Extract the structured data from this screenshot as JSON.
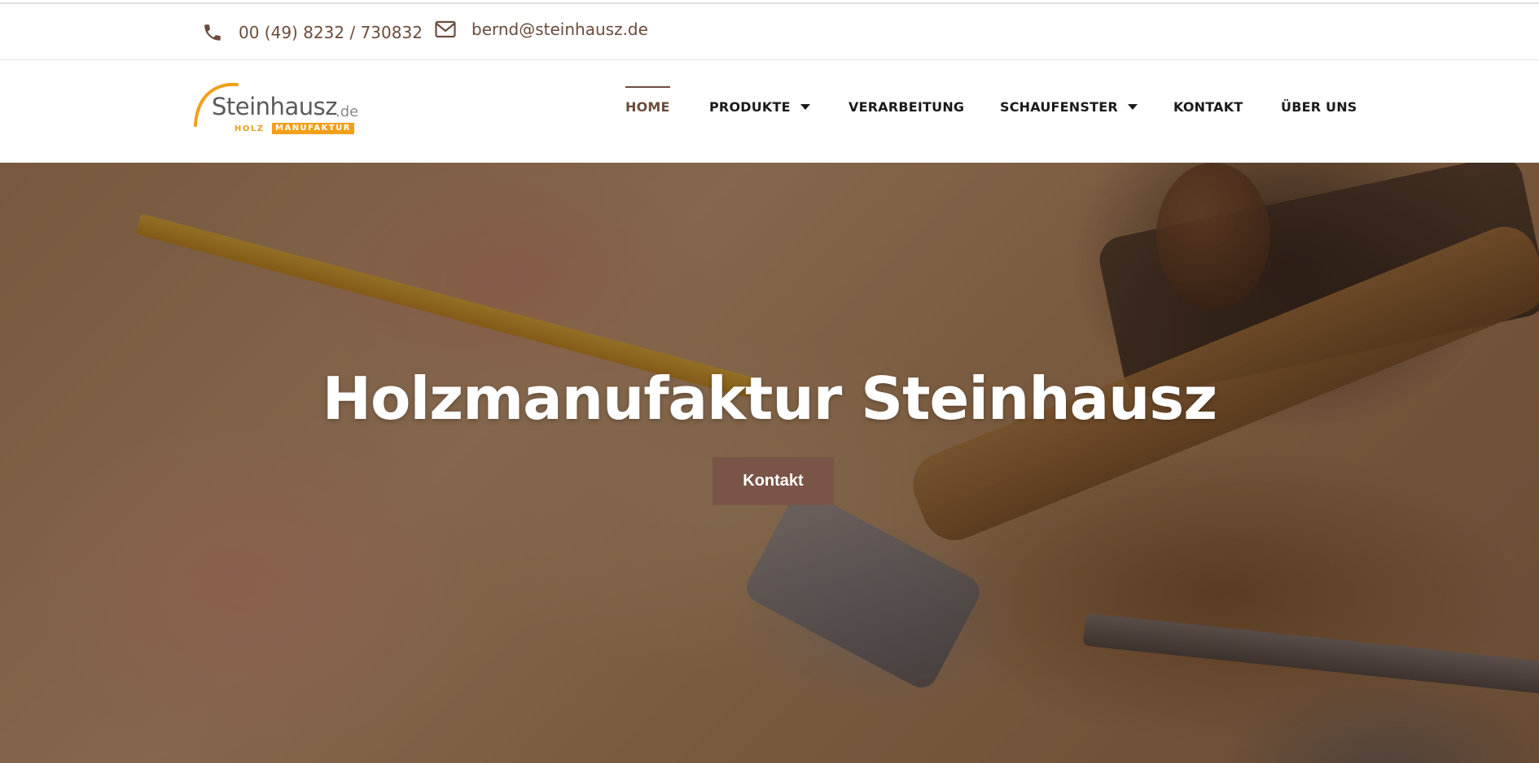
{
  "topbar": {
    "phone": "00 (49) 8232 / 730832",
    "email": "bernd@steinhausz.de",
    "phone_icon": "phone-icon",
    "email_icon": "envelope-icon"
  },
  "logo": {
    "name": "Steinhausz",
    "tld": ".de",
    "holz": "HOLZ",
    "manufaktur": "MANUFAKTUR",
    "brand_color": "#f0a01a"
  },
  "nav": {
    "items": [
      {
        "label": "HOME",
        "active": true
      },
      {
        "label": "PRODUKTE",
        "dropdown": true
      },
      {
        "label": "VERARBEITUNG"
      },
      {
        "label": "SCHAUFENSTER",
        "dropdown": true
      },
      {
        "label": "KONTAKT"
      },
      {
        "label": "ÜBER UNS"
      }
    ],
    "accent_color": "#6b4c3b"
  },
  "hero": {
    "title": "Holzmanufaktur Steinhausz",
    "button_label": "Kontakt",
    "button_color": "#7a5446"
  }
}
